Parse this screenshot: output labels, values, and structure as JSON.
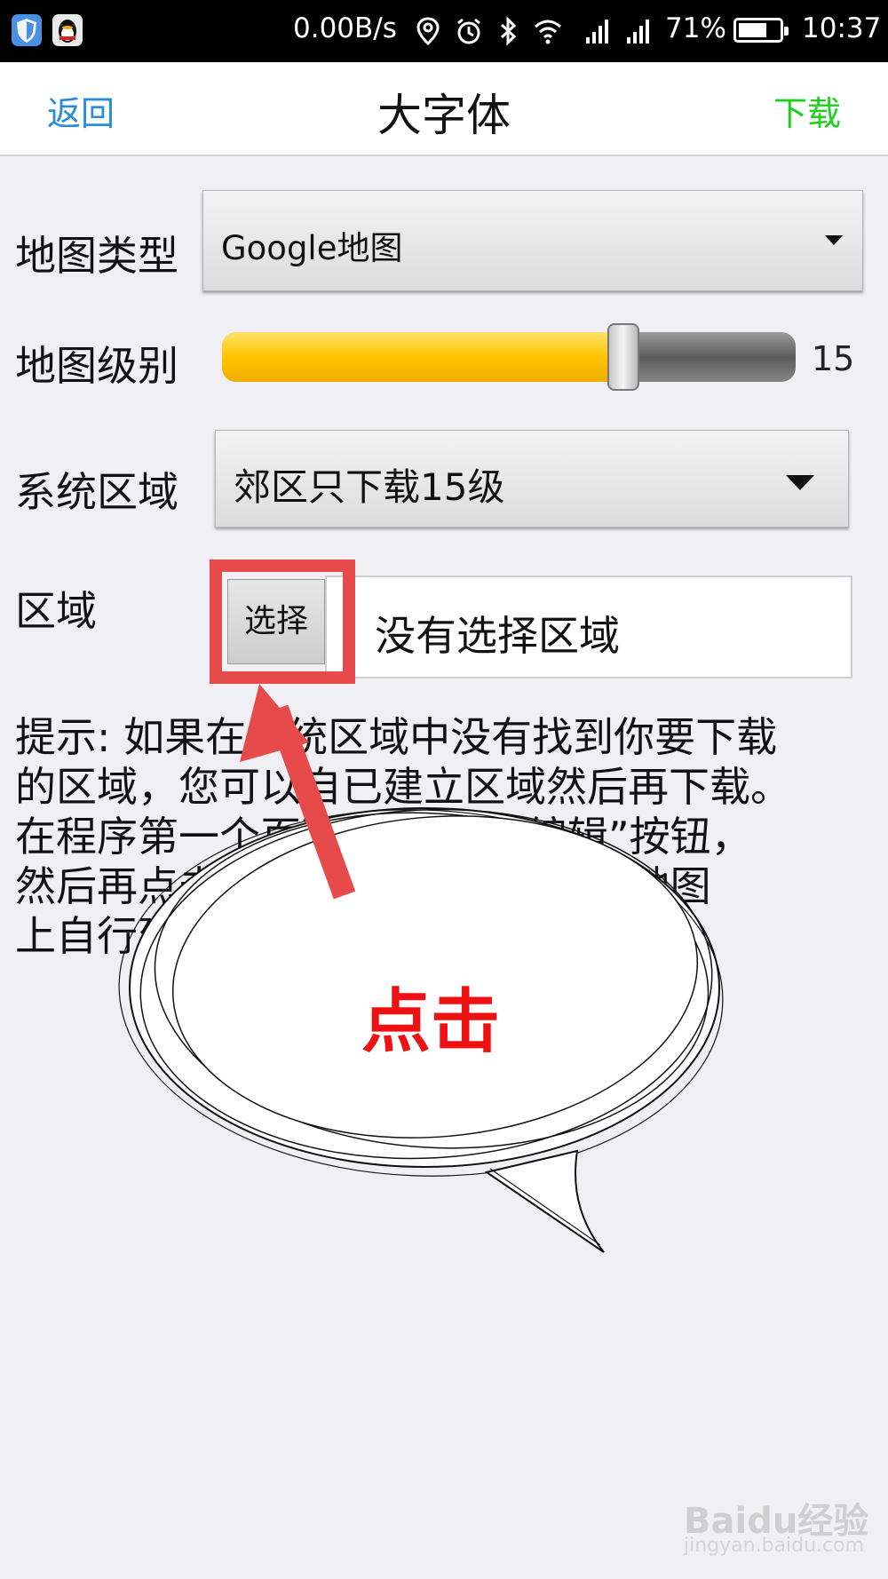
{
  "status_bar": {
    "network_speed": "0.00B/s",
    "battery": "71%",
    "battery_level": 0.71,
    "time": "10:37"
  },
  "nav": {
    "back": "返回",
    "title": "大字体",
    "download": "下载"
  },
  "form": {
    "map_type": {
      "label": "地图类型",
      "value": "Google地图"
    },
    "map_level": {
      "label": "地图级别",
      "value": "15",
      "fraction": 0.7
    },
    "system_region": {
      "label": "系统区域",
      "value": "郊区只下载15级"
    },
    "region": {
      "label": "区域",
      "select_button": "选择",
      "value": "没有选择区域"
    }
  },
  "hint": {
    "lines": [
      "提示: 如果在系统区域中没有找到你要下载",
      "的区域，您可以自已建立区域然后再下载。",
      "在程序第一个页面右上方的“编辑”按钮，",
      "然后再点击“新建区域”，就可以在地图",
      "上自行建立区域。"
    ]
  },
  "annotation": {
    "bubble_text": "点击"
  },
  "watermark": {
    "main": "Baidu经验",
    "sub": "jingyan.baidu.com"
  },
  "colors": {
    "link_blue": "#2a8cdc",
    "download_green": "#1ed01e",
    "annotation_red": "#e74a4a",
    "slider_fill": "#ffc400"
  }
}
